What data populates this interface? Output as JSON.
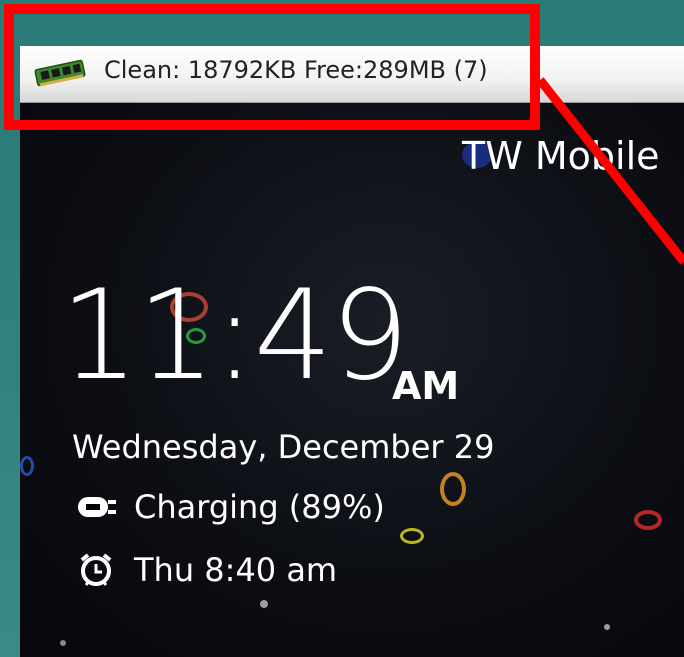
{
  "notification": {
    "text": "Clean: 18792KB Free:289MB (7)",
    "icon": "memory-chip-icon"
  },
  "lockscreen": {
    "carrier": "TW Mobile",
    "time": "11:49",
    "ampm": "AM",
    "date": "Wednesday, December 29",
    "charging": "Charging (89%)",
    "alarm": "Thu 8:40 am"
  },
  "annotation": {
    "highlight_color": "#ff0000"
  }
}
